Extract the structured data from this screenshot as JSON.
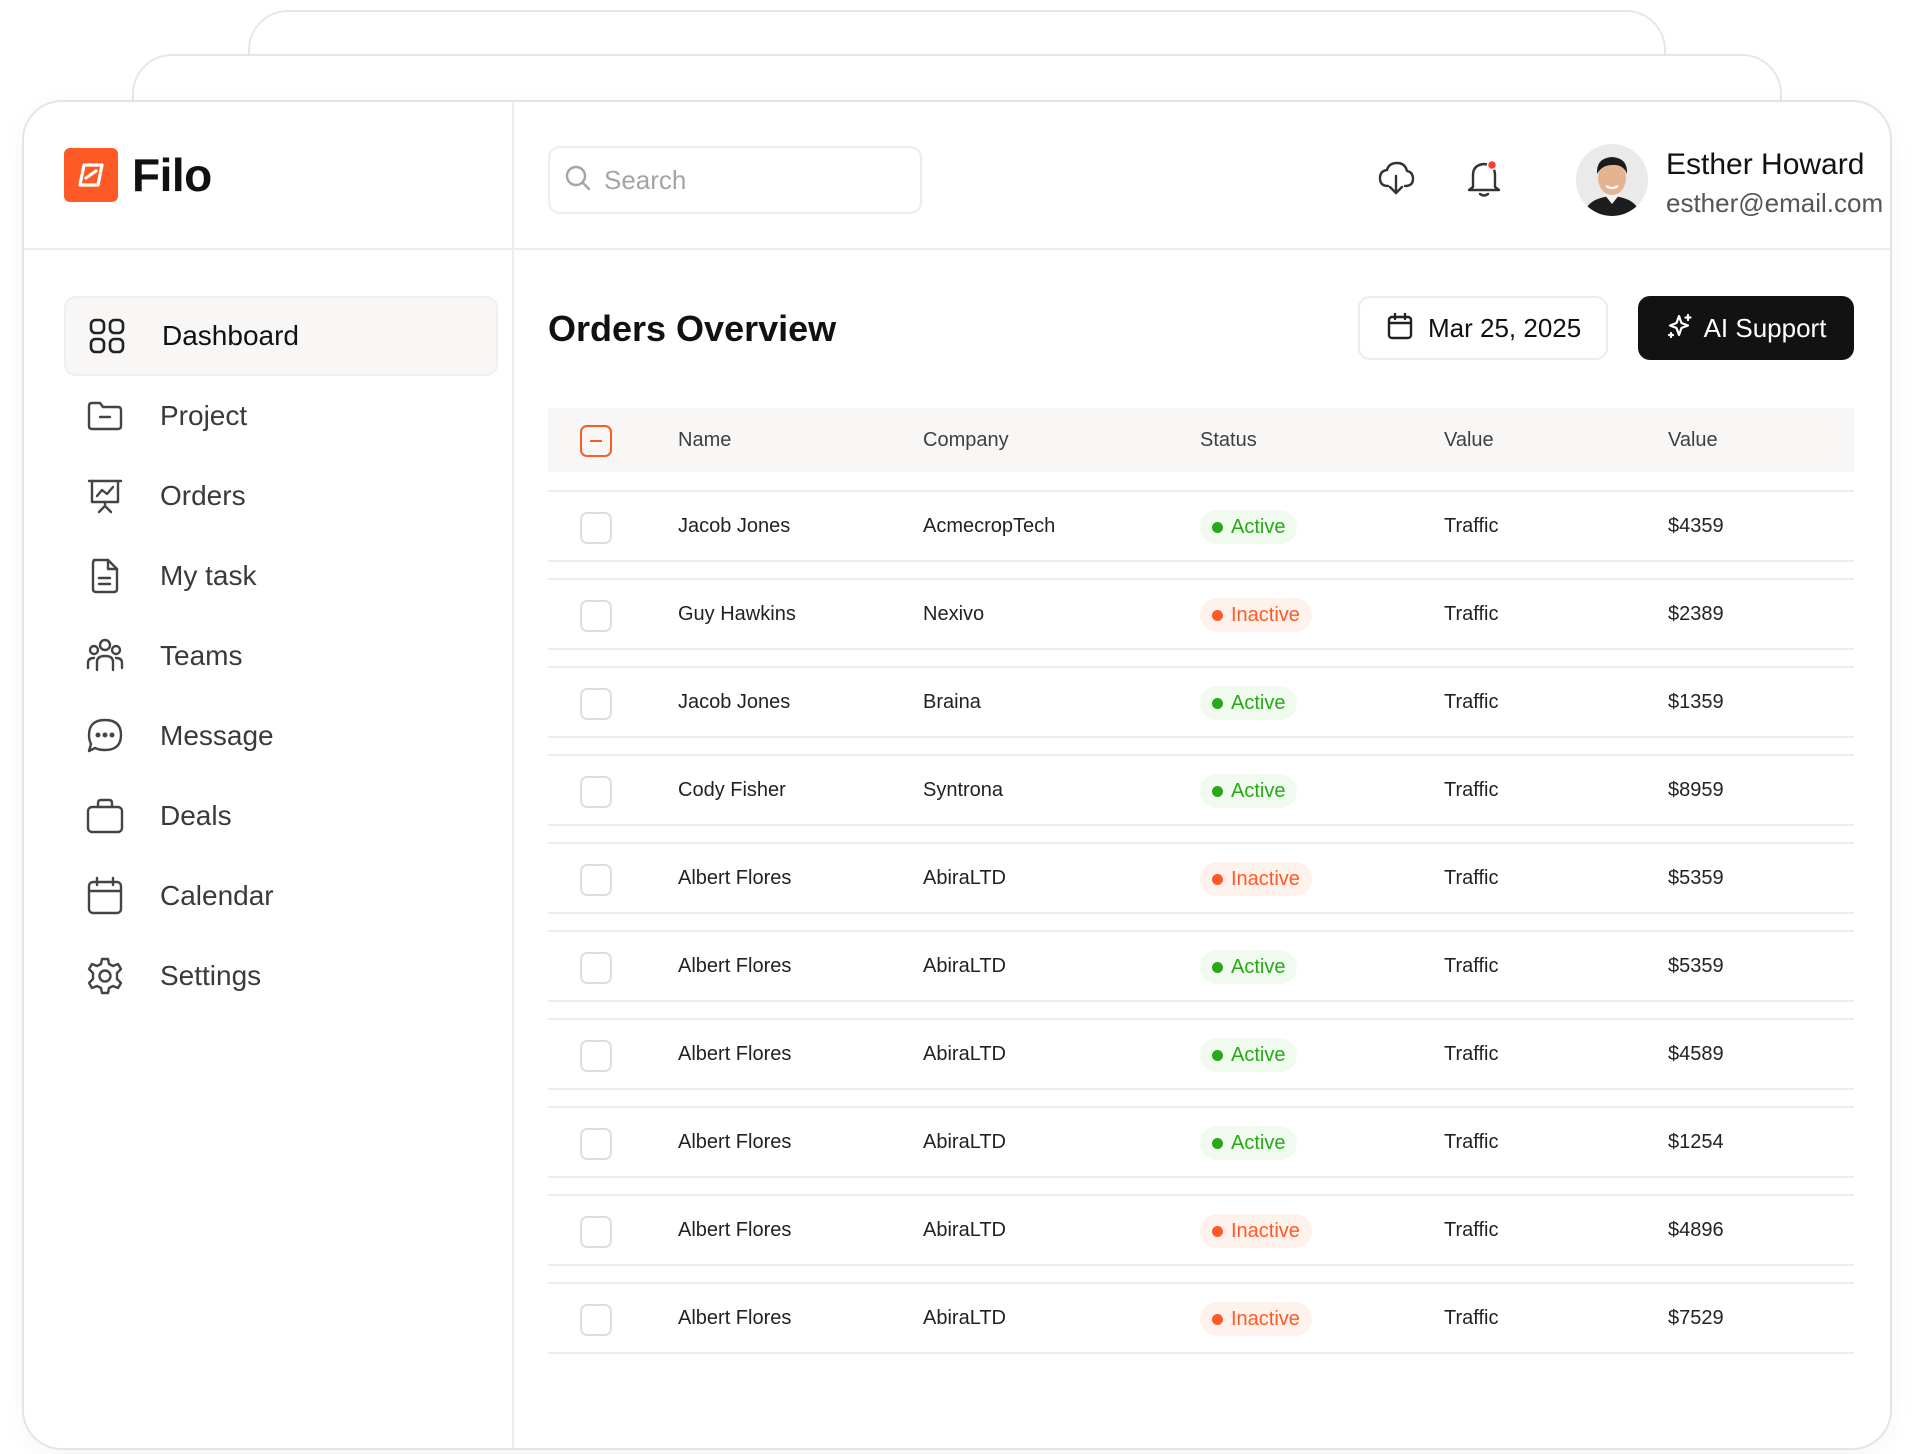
{
  "brand": {
    "name": "Filo",
    "accent": "#ff5a26"
  },
  "sidebar": {
    "items": [
      {
        "label": "Dashboard",
        "icon": "grid-icon",
        "active": true
      },
      {
        "label": "Project",
        "icon": "folder-icon",
        "active": false
      },
      {
        "label": "Orders",
        "icon": "presentation-chart-icon",
        "active": false
      },
      {
        "label": "My task",
        "icon": "document-icon",
        "active": false
      },
      {
        "label": "Teams",
        "icon": "team-icon",
        "active": false
      },
      {
        "label": "Message",
        "icon": "chat-bubble-icon",
        "active": false
      },
      {
        "label": "Deals",
        "icon": "briefcase-icon",
        "active": false
      },
      {
        "label": "Calendar",
        "icon": "calendar-icon",
        "active": false
      },
      {
        "label": "Settings",
        "icon": "gear-icon",
        "active": false
      }
    ]
  },
  "topbar": {
    "search_placeholder": "Search",
    "user": {
      "name": "Esther Howard",
      "email": "esther@email.com"
    },
    "notification_color": "#ff3b30"
  },
  "main": {
    "title": "Orders Overview",
    "date": "Mar 25, 2025",
    "ai_button": "AI Support",
    "table": {
      "columns": [
        "Name",
        "Company",
        "Status",
        "Value",
        "Value"
      ],
      "rows": [
        {
          "name": "Jacob Jones",
          "company": "AcmecropTech",
          "status": "Active",
          "type": "Traffic",
          "value": "$4359"
        },
        {
          "name": "Guy Hawkins",
          "company": "Nexivo",
          "status": "Inactive",
          "type": "Traffic",
          "value": "$2389"
        },
        {
          "name": "Jacob Jones",
          "company": "Braina",
          "status": "Active",
          "type": "Traffic",
          "value": "$1359"
        },
        {
          "name": "Cody Fisher",
          "company": "Syntrona",
          "status": "Active",
          "type": "Traffic",
          "value": "$8959"
        },
        {
          "name": "Albert Flores",
          "company": "AbiraLTD",
          "status": "Inactive",
          "type": "Traffic",
          "value": "$5359"
        },
        {
          "name": "Albert Flores",
          "company": "AbiraLTD",
          "status": "Active",
          "type": "Traffic",
          "value": "$5359"
        },
        {
          "name": "Albert Flores",
          "company": "AbiraLTD",
          "status": "Active",
          "type": "Traffic",
          "value": "$4589"
        },
        {
          "name": "Albert Flores",
          "company": "AbiraLTD",
          "status": "Active",
          "type": "Traffic",
          "value": "$1254"
        },
        {
          "name": "Albert Flores",
          "company": "AbiraLTD",
          "status": "Inactive",
          "type": "Traffic",
          "value": "$4896"
        },
        {
          "name": "Albert Flores",
          "company": "AbiraLTD",
          "status": "Inactive",
          "type": "Traffic",
          "value": "$7529"
        }
      ]
    },
    "status_colors": {
      "Active": "#2aa81a",
      "Inactive": "#ff5a26"
    }
  }
}
